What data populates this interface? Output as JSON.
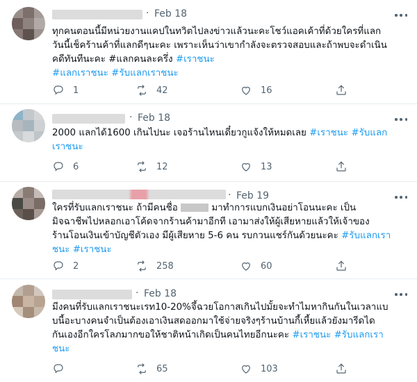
{
  "tweets": [
    {
      "date": "Feb 18",
      "segments": [
        {
          "t": "ทุกคนตอนนี้มีหน่วยงานแคปในทวิตไปลงข่าวแล้วนะคะโชว์แอคเค้าที่ด้วยใครที่แลก\nวันนี้เช็คร้านค้าที่แลกดีๆนะคะ เพราะเห็นว่าเขากำลังจะตรวจสอบและถ้าพบจะดำเนิน\nคดีทันทีนะคะ #แลกคนละครึ่ง ",
          "tag": false
        },
        {
          "t": "#เราชนะ",
          "tag": true
        },
        {
          "t": "\n",
          "tag": false
        },
        {
          "t": "#แลกเราชนะ",
          "tag": true
        },
        {
          "t": " ",
          "tag": false
        },
        {
          "t": "#รับแลกเราชนะ",
          "tag": true
        }
      ],
      "replies": "1",
      "retweets": "42",
      "likes": "16"
    },
    {
      "date": "Feb 18",
      "segments": [
        {
          "t": "2000 แลกได้1600 เกินไปนะ เจอร้านไหนเดี๋ยวกูแจ้งให้หมดเลย ",
          "tag": false
        },
        {
          "t": "#เราชนะ",
          "tag": true
        },
        {
          "t": " ",
          "tag": false
        },
        {
          "t": "#รับแลก\nเราชนะ",
          "tag": true
        }
      ],
      "replies": "6",
      "retweets": "12",
      "likes": "13"
    },
    {
      "date": "Feb 19",
      "segments": [
        {
          "t": "ใครที่รับแลกเราชนะ ถ้ามีคนชื่อ ",
          "tag": false
        },
        {
          "t": "[blur]",
          "tag": false
        },
        {
          "t": " มาทำการแบกเงินอย่าโอนนะคะ เป็น\nมิจฉาชีพไปหลอกเอาโค้ดจากร้านค้ามาอีกที เอามาส่งให้ผู้เสียหายแล้วให้เจ้าของ\nร้านโอนเงินเข้าบัญชีตัวเอง มีผู้เสียหาย 5-6 คน รบกวนแชร์กันด้วยนะคะ ",
          "tag": false
        },
        {
          "t": "#รับแลกเรา\nชนะ",
          "tag": true
        },
        {
          "t": " ",
          "tag": false
        },
        {
          "t": "#เราชนะ",
          "tag": true
        }
      ],
      "replies": "2",
      "retweets": "258",
      "likes": "60"
    },
    {
      "date": "Feb 18",
      "segments": [
        {
          "t": "มีงคนที่รับแลกเราชนะเรท10-20%จึ้ฉวยโอกาสเกินไปมั้ยจะทำไมหากินกันในเวลาแบ\nบนี้อะบางคนจำเป็นต้องเอาเงินสดออกมาใช้จ่ายจริงๆร้านบ้านกี้เหี้ยแล้วยังมารีดได\nกันเองอีกใครโลภมากขอให้ชาติหน้าเกิดเป็นคนไทยอีกนะคะ ",
          "tag": false
        },
        {
          "t": "#เราชนะ",
          "tag": true
        },
        {
          "t": " ",
          "tag": false
        },
        {
          "t": "#รับแลกเรา\nชนะ",
          "tag": true
        }
      ],
      "replies": "",
      "retweets": "65",
      "likes": "103"
    }
  ],
  "colors": {
    "text": "#0f1419",
    "secondary": "#536471",
    "hashtag": "#1d9bf0",
    "divider": "#e6ecf0"
  },
  "icons": [
    "reply-icon",
    "retweet-icon",
    "like-icon",
    "share-icon",
    "more-icon"
  ]
}
